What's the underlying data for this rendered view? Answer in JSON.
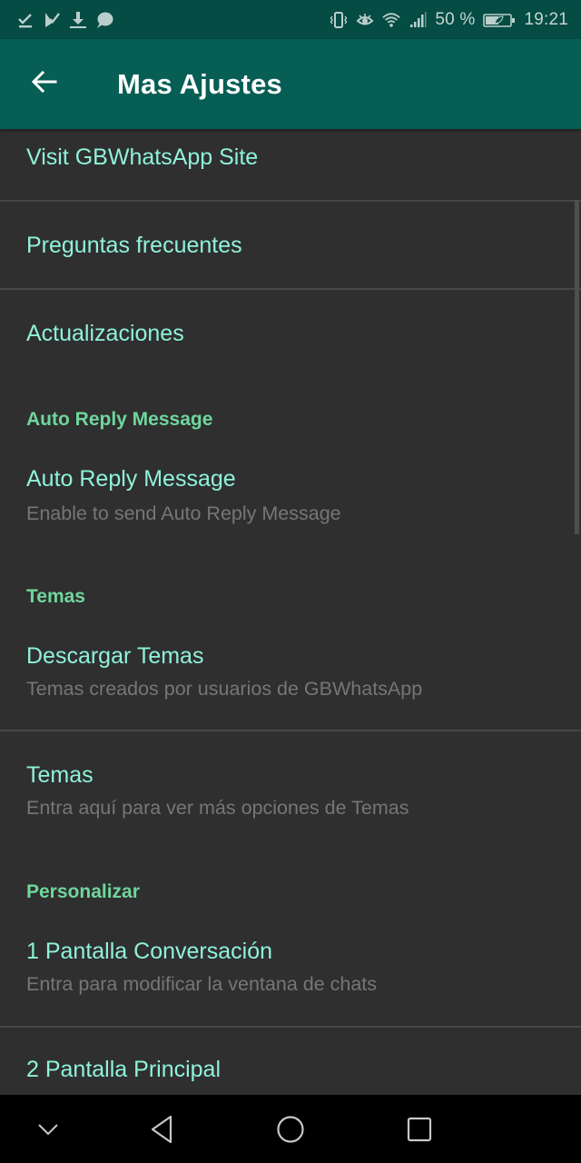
{
  "status_bar": {
    "left_icons": [
      "checkmark-download-icon",
      "play-check-icon",
      "download-icon",
      "message-bubble-icon"
    ],
    "right_icons": [
      "vibrate-icon",
      "eye-comfort-icon",
      "wifi-icon",
      "cellular-signal-icon",
      "battery-charging-icon"
    ],
    "battery_percent": "50 %",
    "time": "19:21"
  },
  "toolbar": {
    "back_icon": "arrow-left-icon",
    "title": "Mas Ajustes"
  },
  "colors": {
    "toolbar": "#075e54",
    "status_bar": "#054c44",
    "background": "#2f2f2f",
    "title_text": "#8ff2d9",
    "section_header": "#6fd69c",
    "summary_text": "#767676"
  },
  "preferences": {
    "visit_site": {
      "title": "Visit GBWhatsApp Site"
    },
    "faq": {
      "title": "Preguntas frecuentes"
    },
    "updates": {
      "title": "Actualizaciones"
    },
    "section_auto_reply": "Auto Reply Message",
    "auto_reply": {
      "title": "Auto Reply Message",
      "summary": "Enable to send Auto Reply Message"
    },
    "section_themes": "Temas",
    "download_themes": {
      "title": "Descargar Temas",
      "summary": "Temas creados por usuarios de GBWhatsApp"
    },
    "themes": {
      "title": "Temas",
      "summary": "Entra aquí para ver más opciones de Temas"
    },
    "section_customize": "Personalizar",
    "conversation_screen": {
      "title": "1 Pantalla Conversación",
      "summary": "Entra para modificar la ventana de chats"
    },
    "main_screen": {
      "title": "2 Pantalla Principal"
    }
  },
  "nav_bar": {
    "buttons": [
      "hide-nav-icon",
      "back-triangle-icon",
      "home-circle-icon",
      "recents-square-icon"
    ]
  }
}
